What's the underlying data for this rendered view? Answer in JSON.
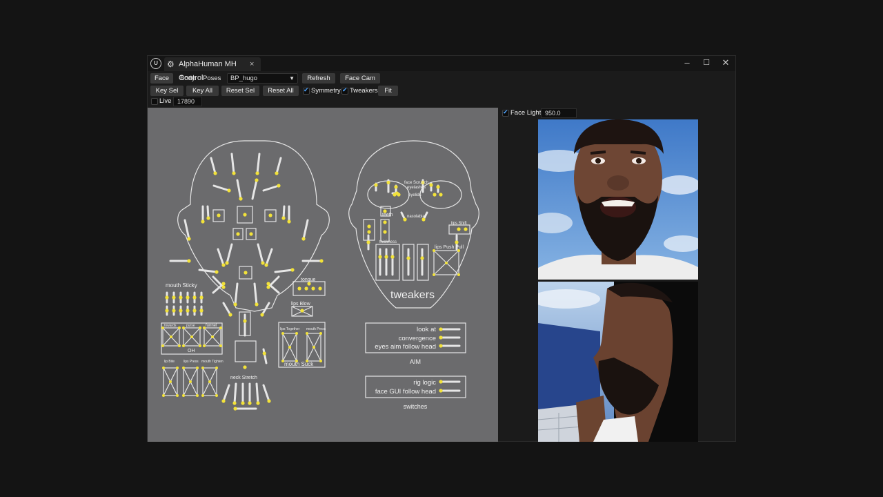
{
  "window": {
    "tab_title": "AlphaHuman MH Control",
    "close_tab": "×",
    "minimize": "–",
    "maximize": "☐",
    "close": "✕"
  },
  "toolbar1": {
    "face": "Face",
    "body": "Body",
    "poses": "Poses",
    "blueprint": "BP_hugo",
    "refresh": "Refresh",
    "face_cam": "Face Cam"
  },
  "toolbar2": {
    "key_sel": "Key Sel",
    "key_all": "Key All",
    "reset_sel": "Reset Sel",
    "reset_all": "Reset All",
    "symmetry": "Symmetry",
    "tweakers": "Tweakers",
    "fit": "Fit"
  },
  "live": {
    "label": "Live",
    "value": "17890"
  },
  "face_light": {
    "label": "Face Light",
    "value": "950.0"
  },
  "gui": {
    "mouth_sticky": "mouth Sticky",
    "tongue": "tongue",
    "lips_blow": "lips Blow",
    "towards": "towards",
    "purse": "purse",
    "funnel": "funnel",
    "oh": "OH",
    "lip_bite": "lip Bite",
    "lips_press": "lips Press",
    "mouth_tighten": "mouth Tighten",
    "lips_together": "lips Together",
    "mouth_press": "mouth Press",
    "mouth_suck": "mouth Suck",
    "neck_stretch": "neck Stretch",
    "face_scrunch": "face Scrunch",
    "eyelashes": "eyelashes",
    "eyelids": "eyelids",
    "teeth": "teeth",
    "nasolabial": "nasolabial",
    "lips_shift": "lips Shift",
    "thickness": "thickness",
    "lips_push_pull": "lips Push Pull",
    "tweakers": "tweakers",
    "look_at": "look at",
    "convergence": "convergence",
    "eyes_aim": "eyes aim follow head",
    "aim": "AIM",
    "rig_logic": "rig logic",
    "face_gui_follow": "face GUI follow head",
    "switches": "switches"
  },
  "colors": {
    "accent": "#4da3ff",
    "control_yellow": "#f2e23a",
    "canvas_bg": "#6b6b6d",
    "line": "#e6e6e6"
  }
}
